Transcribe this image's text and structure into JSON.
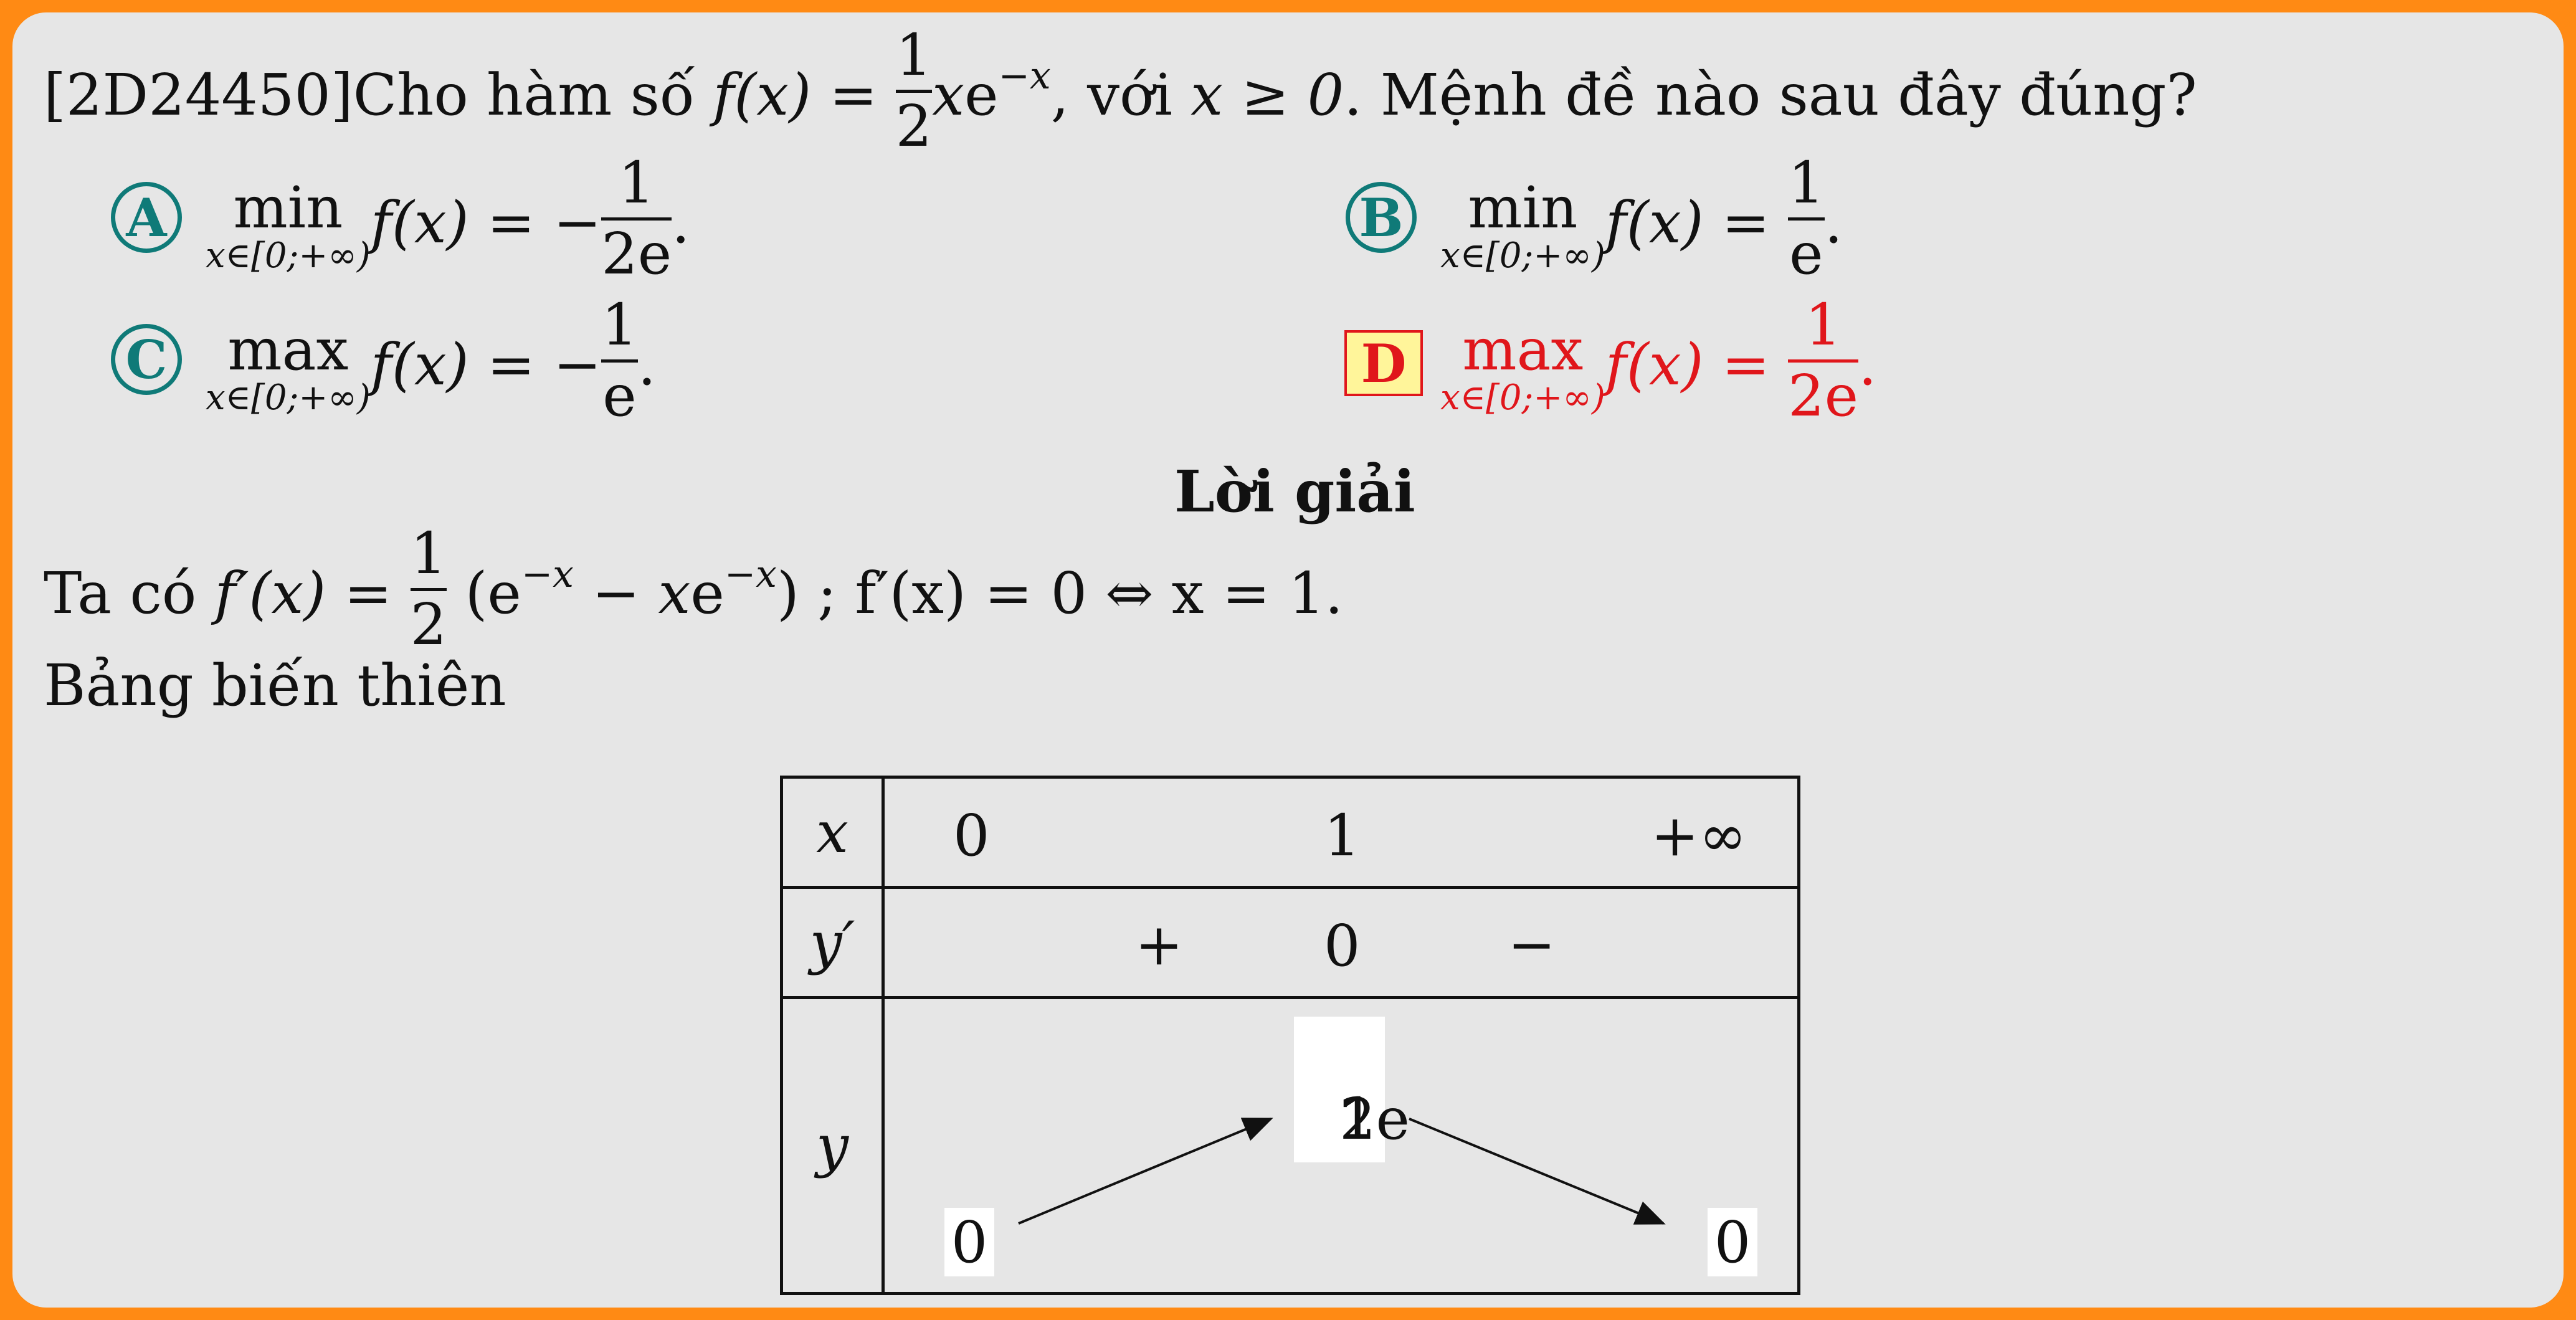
{
  "question": {
    "code": "[2D24450]",
    "stem_pre": "Cho hàm số ",
    "func": "f(x)",
    "eq": " = ",
    "frac_num": "1",
    "frac_den": "2",
    "x": "x",
    "e": "e",
    "exp": "−x",
    "stem_mid": ", với ",
    "cond": "x ≥ 0",
    "stem_post": ". Mệnh đề nào sau đây đúng?"
  },
  "options": [
    {
      "label": "A",
      "op": "min",
      "sub": "x∈[0;+∞)",
      "lhs": "f(x) = −",
      "num": "1",
      "den": "2e",
      "tail": "."
    },
    {
      "label": "B",
      "op": "min",
      "sub": "x∈[0;+∞)",
      "lhs": "f(x) = ",
      "num": "1",
      "den": "e",
      "tail": "."
    },
    {
      "label": "C",
      "op": "max",
      "sub": "x∈[0;+∞)",
      "lhs": "f(x) = −",
      "num": "1",
      "den": "e",
      "tail": "."
    },
    {
      "label": "D",
      "op": "max",
      "sub": "x∈[0;+∞)",
      "lhs": "f(x) = ",
      "num": "1",
      "den": "2e",
      "tail": ".",
      "correct": true
    }
  ],
  "solution": {
    "heading": "Lời giải",
    "line1_pre": "Ta có ",
    "fprime": "f′(x)",
    "eq": " = ",
    "num": "1",
    "den": "2",
    "paren_open": " (e",
    "exp1": "−x",
    "mid": " − x",
    "e2": "e",
    "exp2": "−x",
    "paren_close": ")",
    "line1_post": " ; f′(x) = 0 ⇔ x = 1.",
    "line2": "Bảng biến thiên"
  },
  "table": {
    "row_x": {
      "label": "x",
      "v0": "0",
      "v1": "1",
      "v2": "+∞"
    },
    "row_yp": {
      "label": "y′",
      "s1": "+",
      "z": "0",
      "s2": "−"
    },
    "row_y": {
      "label": "y",
      "left": "0",
      "top_num": "1",
      "top_den": "2e",
      "right": "0"
    }
  },
  "colors": {
    "border": "#ff8a14",
    "panel": "#e6e6e6",
    "teal": "#0f7a78",
    "correct": "#e0161b",
    "highlight": "#fff59a"
  }
}
